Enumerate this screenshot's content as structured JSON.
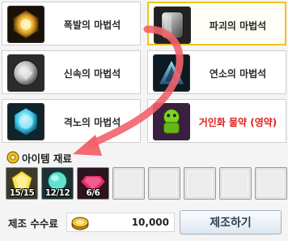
{
  "recipes": [
    {
      "label": "폭발의 마법석",
      "icon": "explosion-magic-stone-icon",
      "selected": false,
      "color": "#2a2a2a"
    },
    {
      "label": "파괴의 마법석",
      "icon": "destruction-magic-stone-icon",
      "selected": true,
      "color": "#2a2a2a"
    },
    {
      "label": "신속의 마법석",
      "icon": "swiftness-magic-stone-icon",
      "selected": false,
      "color": "#2a2a2a"
    },
    {
      "label": "연소의 마법석",
      "icon": "combustion-magic-stone-icon",
      "selected": false,
      "color": "#2a2a2a"
    },
    {
      "label": "격노의 마법석",
      "icon": "rage-magic-stone-icon",
      "selected": false,
      "color": "#2a2a2a"
    },
    {
      "label": "거인화 물약 (영약)",
      "icon": "giant-potion-icon",
      "selected": false,
      "color": "#e0201b"
    }
  ],
  "materials": {
    "title": "아이템 재료",
    "slots": [
      {
        "icon": "yellow-gem-icon",
        "count": "15/15"
      },
      {
        "icon": "teal-gem-icon",
        "count": "12/12"
      },
      {
        "icon": "ruby-gem-icon",
        "count": "6/6"
      },
      {
        "icon": "empty-slot"
      },
      {
        "icon": "empty-slot"
      },
      {
        "icon": "empty-slot"
      },
      {
        "icon": "empty-slot"
      },
      {
        "icon": "empty-slot"
      }
    ]
  },
  "fee": {
    "label": "제조 수수료",
    "value": "10,000",
    "icon": "gold-coin-icon"
  },
  "craft_button": {
    "label": "제조하기"
  },
  "colors": {
    "selected_border": "#f0c419",
    "arrow": "#f2626a",
    "fee_name_red": "#e0201b"
  }
}
